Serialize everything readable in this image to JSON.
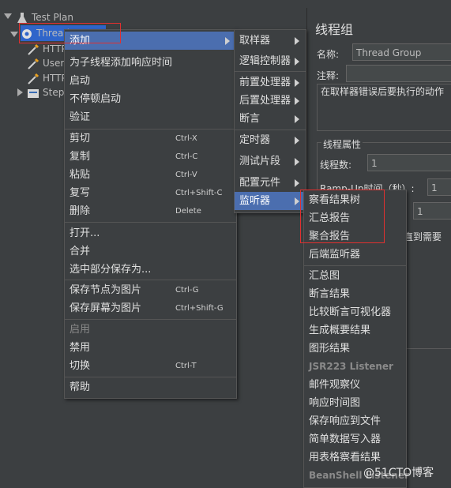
{
  "tree": {
    "test_plan": "Test Plan",
    "thread_group": "Thread Group",
    "child1": "HTTP",
    "child2": "User",
    "child3": "HTTP",
    "child4": "Step"
  },
  "right_panel": {
    "title": "线程组",
    "name_label": "名称:",
    "name_value": "Thread Group",
    "comment_label": "注释:",
    "on_error_label": "在取样器错误后要执行的动作",
    "thread_props_label": "线程属性",
    "num_threads_label": "线程数:",
    "num_threads_value": "1",
    "rampup_label": "Ramp-Up时间（秒）:",
    "rampup_value": "1",
    "loop_value": "1",
    "until_needed_label": "直到需要"
  },
  "context_menu": {
    "items": [
      {
        "label": "添加",
        "submenu": true
      },
      {
        "label": "为子线程添加响应时间"
      },
      {
        "label": "启动"
      },
      {
        "label": "不停顿启动"
      },
      {
        "label": "验证"
      },
      {
        "label": "剪切",
        "shortcut": "Ctrl-X"
      },
      {
        "label": "复制",
        "shortcut": "Ctrl-C"
      },
      {
        "label": "粘贴",
        "shortcut": "Ctrl-V"
      },
      {
        "label": "复写",
        "shortcut": "Ctrl+Shift-C"
      },
      {
        "label": "删除",
        "shortcut": "Delete"
      },
      {
        "label": "打开..."
      },
      {
        "label": "合并"
      },
      {
        "label": "选中部分保存为..."
      },
      {
        "label": "保存节点为图片",
        "shortcut": "Ctrl-G"
      },
      {
        "label": "保存屏幕为图片",
        "shortcut": "Ctrl+Shift-G"
      },
      {
        "label": "启用"
      },
      {
        "label": "禁用"
      },
      {
        "label": "切换",
        "shortcut": "Ctrl-T"
      },
      {
        "label": "帮助"
      }
    ]
  },
  "add_menu": {
    "items": [
      "取样器",
      "逻辑控制器",
      "前置处理器",
      "后置处理器",
      "断言",
      "定时器",
      "测试片段",
      "配置元件",
      "监听器"
    ]
  },
  "listener_menu": {
    "items": [
      "察看结果树",
      "汇总报告",
      "聚合报告",
      "后端监听器",
      "汇总图",
      "断言结果",
      "比较断言可视化器",
      "生成概要结果",
      "图形结果",
      "JSR223 Listener",
      "邮件观察仪",
      "响应时间图",
      "保存响应到文件",
      "简单数据写入器",
      "用表格察看结果",
      "BeanShell Listener"
    ]
  },
  "watermark": "@51CTO博客",
  "colors": {
    "menu_bg": "#3c3f41",
    "selected_bg": "#4b6eaf",
    "highlight_box": "#e03030"
  }
}
